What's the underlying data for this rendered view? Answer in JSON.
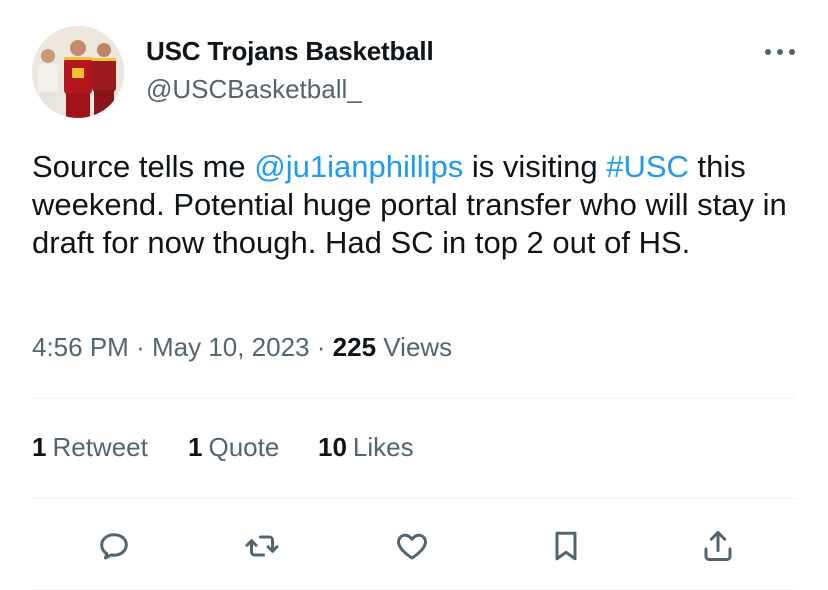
{
  "author": {
    "name": "USC Trojans Basketball",
    "handle": "@USCBasketball_"
  },
  "tweet": {
    "text_1": "Source tells me ",
    "mention": "@ju1ianphillips",
    "text_2": " is visiting ",
    "hashtag": "#USC",
    "text_3": " this weekend. Potential huge portal transfer who will stay in draft for now though.  Had SC in top 2 out of HS."
  },
  "meta": {
    "time": "4:56 PM",
    "separator": "·",
    "date": "May 10, 2023",
    "views_count": "225",
    "views_label": "Views"
  },
  "stats": {
    "retweets_count": "1",
    "retweets_label": "Retweet",
    "quotes_count": "1",
    "quotes_label": "Quote",
    "likes_count": "10",
    "likes_label": "Likes"
  },
  "colors": {
    "link": "#1d9bf0",
    "secondary_text": "#536471",
    "primary_text": "#0f1419",
    "divider": "#eff3f4"
  },
  "icons": {
    "more": "more-horizontal-icon",
    "reply": "reply-icon",
    "retweet": "retweet-icon",
    "like": "heart-icon",
    "bookmark": "bookmark-icon",
    "share": "share-icon"
  }
}
